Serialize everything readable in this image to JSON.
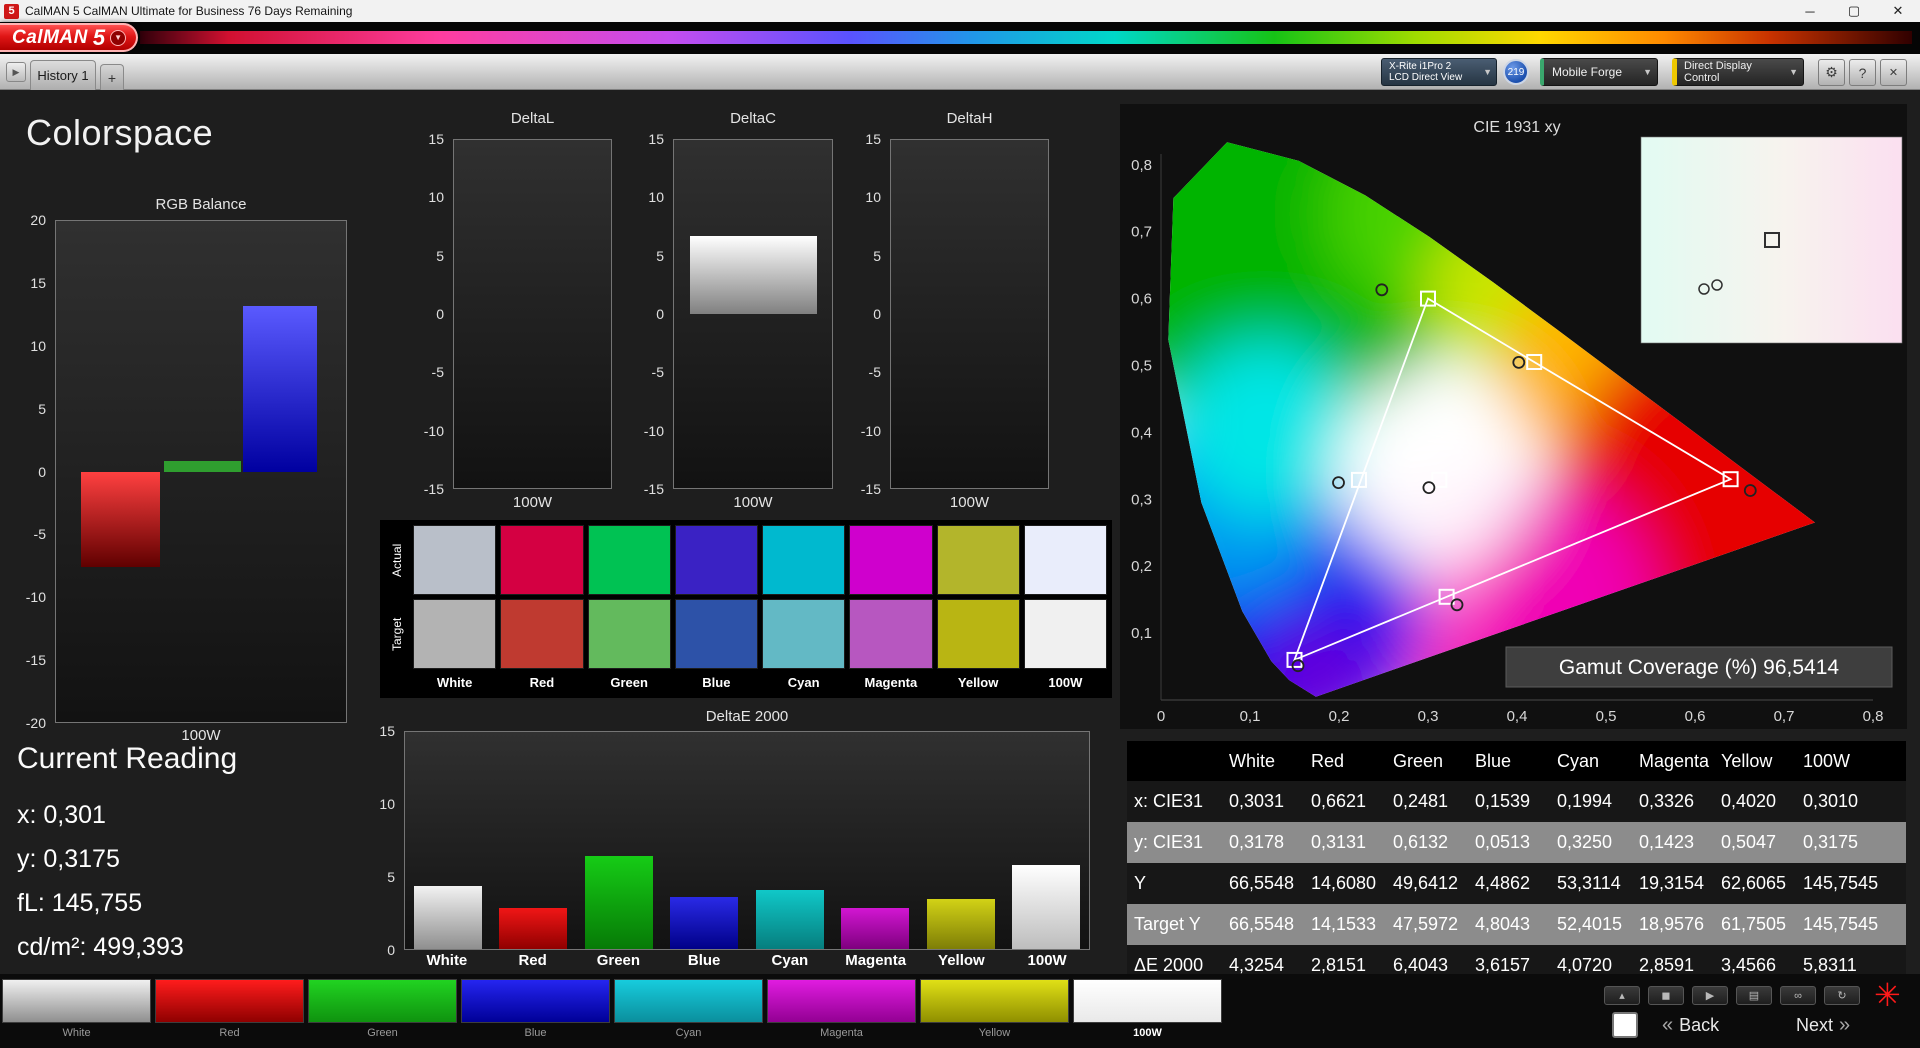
{
  "window": {
    "title": "CalMAN 5 CalMAN Ultimate for Business 76 Days Remaining",
    "app_icon": "5",
    "logo_text": "CalMAN",
    "logo_five": "5"
  },
  "icons": {
    "minimize": "─",
    "maximize": "▢",
    "close": "✕",
    "dropdown": "▼",
    "nav_arrow": "▶",
    "gear": "⚙",
    "help": "?",
    "panel_close": "✕",
    "eject": "▴",
    "stop": "◼",
    "play": "▶",
    "pattern": "▤",
    "loop": "∞",
    "refresh": "↻",
    "back_chevron": "«",
    "next_chevron": "»",
    "busy_asterisk": "✳",
    "add_tab": "+"
  },
  "tabbar": {
    "history_tab": "History 1",
    "meter": {
      "line1": "X-Rite i1Pro 2",
      "line2": "LCD Direct View"
    },
    "badge": "219",
    "source": "Mobile Forge",
    "display_control": "Direct Display Control"
  },
  "page": {
    "title": "Colorspace"
  },
  "current_reading": {
    "heading": "Current Reading",
    "lines": [
      "x: 0,301",
      "y: 0,3175",
      "fL: 145,755",
      "cd/m²: 499,393"
    ]
  },
  "chart_data": [
    {
      "type": "bar",
      "title": "RGB Balance",
      "categories": [
        "Red",
        "Green",
        "Blue"
      ],
      "values": [
        -7.6,
        0.8,
        13.2
      ],
      "bar_colors": [
        [
          "#ff4040",
          "#600000"
        ],
        [
          "#2f9e2f",
          "#2f9e2f"
        ],
        [
          "#5a5aff",
          "#0000a0"
        ]
      ],
      "xlabel": "100W",
      "ylim": [
        -20,
        20
      ],
      "yticks": [
        "20",
        "15",
        "10",
        "5",
        "0",
        "-5",
        "-10",
        "-15",
        "-20"
      ]
    },
    {
      "type": "bar",
      "title": "DeltaL",
      "categories": [
        "100W"
      ],
      "values": [],
      "xlabel": "100W",
      "ylim": [
        -15,
        15
      ],
      "yticks": [
        "15",
        "10",
        "5",
        "0",
        "-5",
        "-10",
        "-15"
      ]
    },
    {
      "type": "bar",
      "title": "DeltaC",
      "categories": [
        "100W"
      ],
      "values": [
        6.7
      ],
      "bar_colors": [
        [
          "#ffffff",
          "#808080"
        ]
      ],
      "xlabel": "100W",
      "ylim": [
        -15,
        15
      ],
      "yticks": [
        "15",
        "10",
        "5",
        "0",
        "-5",
        "-10",
        "-15"
      ]
    },
    {
      "type": "bar",
      "title": "DeltaH",
      "categories": [
        "100W"
      ],
      "values": [],
      "xlabel": "100W",
      "ylim": [
        -15,
        15
      ],
      "yticks": [
        "15",
        "10",
        "5",
        "0",
        "-5",
        "-10",
        "-15"
      ]
    },
    {
      "type": "bar",
      "title": "DeltaE 2000",
      "categories": [
        "White",
        "Red",
        "Green",
        "Blue",
        "Cyan",
        "Magenta",
        "Yellow",
        "100W"
      ],
      "values": [
        4.3254,
        2.8151,
        6.4043,
        3.6157,
        4.072,
        2.8591,
        3.4566,
        5.8311
      ],
      "bar_colors": [
        [
          "#f2f2f2",
          "#8f8f8f"
        ],
        [
          "#f01616",
          "#900000"
        ],
        [
          "#16cc16",
          "#067a06"
        ],
        [
          "#2a2ae6",
          "#000088"
        ],
        [
          "#10c8c8",
          "#067e7e"
        ],
        [
          "#d216d2",
          "#7e007e"
        ],
        [
          "#d2d216",
          "#7e7e06"
        ],
        [
          "#ffffff",
          "#bdbdbd"
        ]
      ],
      "ylim": [
        0,
        15
      ],
      "yticks": [
        "15",
        "10",
        "5",
        "0"
      ]
    },
    {
      "type": "scatter",
      "title": "CIE 1931 xy",
      "xlim": [
        0,
        0.8
      ],
      "ylim": [
        0,
        0.9
      ],
      "x_ticks": [
        "0",
        "0,1",
        "0,2",
        "0,3",
        "0,4",
        "0,5",
        "0,6",
        "0,7",
        "0,8"
      ],
      "y_ticks": [
        "0,1",
        "0,2",
        "0,3",
        "0,4",
        "0,5",
        "0,6",
        "0,7",
        "0,8"
      ],
      "gamut_coverage_label": "Gamut Coverage (%) 96,5414",
      "gamut_triangle": [
        [
          0.64,
          0.33
        ],
        [
          0.3,
          0.6
        ],
        [
          0.15,
          0.06
        ]
      ],
      "targets": [
        [
          0.3127,
          0.329
        ],
        [
          0.64,
          0.33
        ],
        [
          0.3,
          0.6
        ],
        [
          0.15,
          0.06
        ],
        [
          0.2225,
          0.329
        ],
        [
          0.3209,
          0.1542
        ],
        [
          0.4193,
          0.5053
        ]
      ],
      "measured": [
        [
          0.301,
          0.3175
        ],
        [
          0.6621,
          0.3131
        ],
        [
          0.2481,
          0.6132
        ],
        [
          0.1539,
          0.0513
        ],
        [
          0.1994,
          0.325
        ],
        [
          0.3326,
          0.1423
        ],
        [
          0.402,
          0.5047
        ]
      ]
    }
  ],
  "swatch_grid": {
    "row_labels": [
      "Actual",
      "Target"
    ],
    "column_labels": [
      "White",
      "Red",
      "Green",
      "Blue",
      "Cyan",
      "Magenta",
      "Yellow",
      "100W"
    ],
    "actual_colors": [
      "#b9bfc9",
      "#d40042",
      "#00c253",
      "#3a22c4",
      "#00b9cf",
      "#cf00cd",
      "#b3b52b",
      "#e9edfb"
    ],
    "target_colors": [
      "#b3b3b3",
      "#bf3a30",
      "#63ba5d",
      "#2d52a8",
      "#63b9c5",
      "#b757c0",
      "#b9b513",
      "#f0f0f0"
    ]
  },
  "table": {
    "headers": [
      "",
      "White",
      "Red",
      "Green",
      "Blue",
      "Cyan",
      "Magenta",
      "Yellow",
      "100W"
    ],
    "rows": [
      {
        "label": "x: CIE31",
        "values": [
          "0,3031",
          "0,6621",
          "0,2481",
          "0,1539",
          "0,1994",
          "0,3326",
          "0,4020",
          "0,3010"
        ]
      },
      {
        "label": "y: CIE31",
        "values": [
          "0,3178",
          "0,3131",
          "0,6132",
          "0,0513",
          "0,3250",
          "0,1423",
          "0,5047",
          "0,3175"
        ]
      },
      {
        "label": "Y",
        "values": [
          "66,5548",
          "14,6080",
          "49,6412",
          "4,4862",
          "53,3114",
          "19,3154",
          "62,6065",
          "145,7545"
        ]
      },
      {
        "label": "Target Y",
        "values": [
          "66,5548",
          "14,1533",
          "47,5972",
          "4,8043",
          "52,4015",
          "18,9576",
          "61,7505",
          "145,7545"
        ]
      },
      {
        "label": "ΔE 2000",
        "values": [
          "4,3254",
          "2,8151",
          "6,4043",
          "3,6157",
          "4,0720",
          "2,8591",
          "3,4566",
          "5,8311"
        ]
      }
    ]
  },
  "bottom_strip": {
    "labels": [
      "White",
      "Red",
      "Green",
      "Blue",
      "Cyan",
      "Magenta",
      "Yellow",
      "100W"
    ],
    "colors": [
      [
        "#f0f0f0",
        "#8f8f8f"
      ],
      [
        "#ff1c1c",
        "#8f0000"
      ],
      [
        "#21d321",
        "#0f930f"
      ],
      [
        "#2525f0",
        "#000097"
      ],
      [
        "#17ccdd",
        "#0b8f9d"
      ],
      [
        "#e01ce0",
        "#930093"
      ],
      [
        "#e0e016",
        "#8f8f00"
      ],
      [
        "#ffffff",
        "#e9e9e9"
      ]
    ]
  },
  "transport": {
    "back": "Back",
    "next": "Next"
  }
}
